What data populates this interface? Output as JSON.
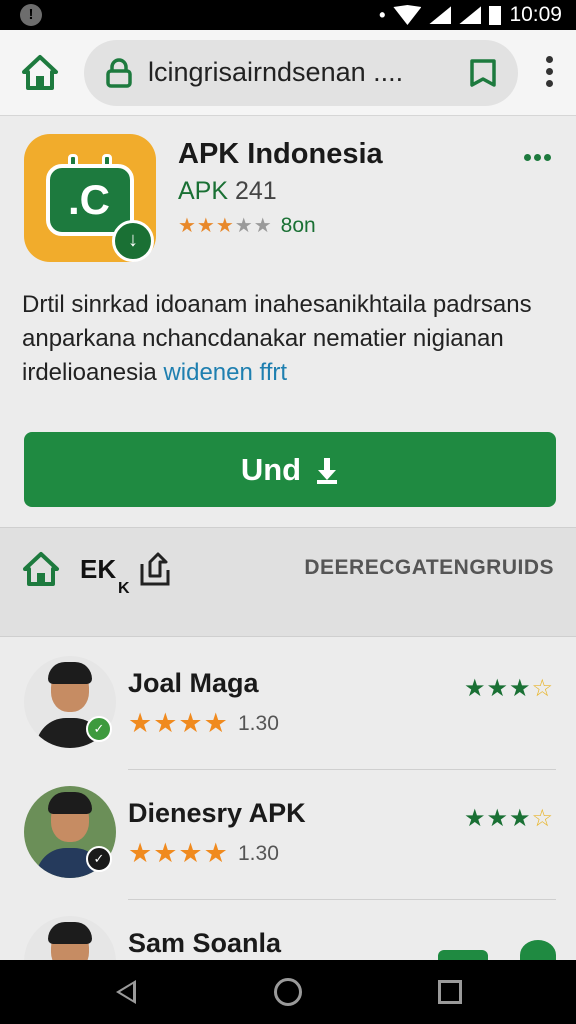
{
  "status_bar": {
    "time": "10:09",
    "left_icon": "!",
    "bt_icon": "bluetooth-icon"
  },
  "browser": {
    "url": "lcingrisairndsenan ....",
    "icons": [
      "home-icon",
      "lock-icon",
      "bookmark-icon",
      "overflow-menu-icon"
    ]
  },
  "app": {
    "title": "APK Indonesia",
    "version_prefix": "APK",
    "version_number": "241",
    "rating_label": "8on",
    "rating_stars": 3,
    "description_lines": [
      "Drtil sinrkad idoanam inahesanikhtaila padrsans",
      "anparkana nchancdanakar nematier nigianan"
    ],
    "description_last": "irdelioanesia",
    "description_link": "widenen ffrt",
    "install_label": "Und"
  },
  "section": {
    "tab_label": "EK",
    "sub_label": "K",
    "right_label": "DEERECGATENGRUIDS"
  },
  "reviews": [
    {
      "name": "Joal Maga",
      "stars": 4,
      "score": "1.30",
      "right_rating": 3.5
    },
    {
      "name": "Dienesry APK",
      "stars": 4,
      "score": "1.30",
      "right_rating": 3.5
    },
    {
      "name": "Sam Soanla"
    }
  ],
  "colors": {
    "accent_green": "#1f8a41",
    "star_orange": "#f08a1e",
    "link_blue": "#1e7fb0",
    "icon_bg": "#f1ac2c"
  }
}
